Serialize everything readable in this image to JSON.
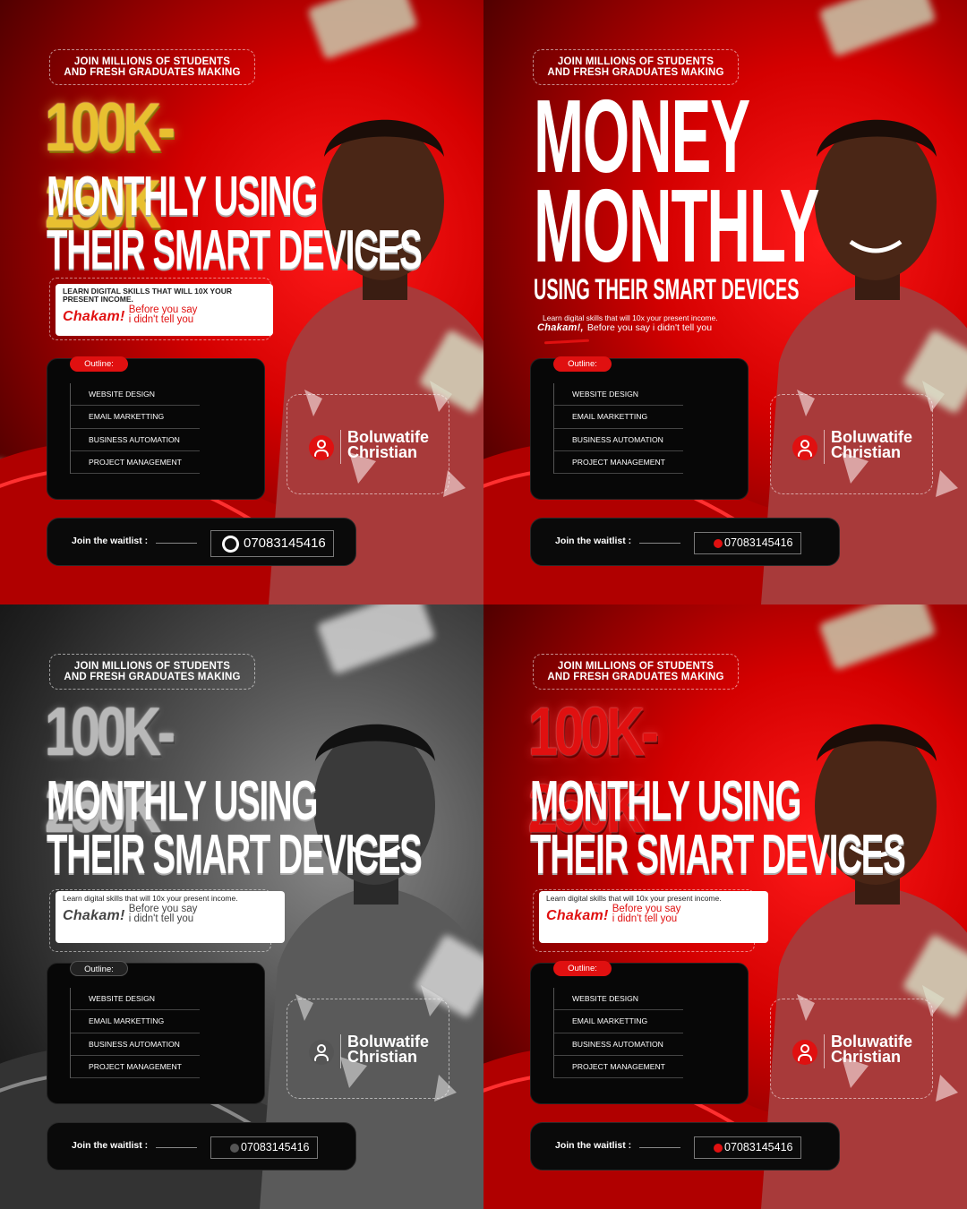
{
  "posters": [
    {
      "variant": "gold",
      "top_line1": "JOIN MILLIONS OF STUDENTS",
      "top_line2": "AND FRESH GRADUATES MAKING",
      "headline_number": "100K-250K",
      "headline_line1": "MONTHLY USING",
      "headline_line2": "THEIR SMART DEVICES",
      "skill_text": "LEARN DIGITAL SKILLS THAT WILL 10X YOUR PRESENT INCOME.",
      "chakam": "Chakam!",
      "before_line1": "Before you say",
      "before_line2": "i didn't tell you",
      "outline_label": "Outline:",
      "outline_items": [
        "WEBSITE DESIGN",
        "EMAIL MARKETTING",
        "BUSINESS AUTOMATION",
        "PROJECT MANAGEMENT"
      ],
      "name_line1": "Boluwatife",
      "name_line2": "Christian",
      "waitlist_label": "Join the waitlist :",
      "phone": "07083145416"
    },
    {
      "variant": "money",
      "top_line1": "JOIN MILLIONS OF STUDENTS",
      "top_line2": "AND FRESH GRADUATES MAKING",
      "headline_line1": "MONEY",
      "headline_line2": "MONTHLY",
      "headline_sub": "USING THEIR SMART DEVICES",
      "skill_text": "Learn  digital skills that will 10x your present income.",
      "chakam": "Chakam!,",
      "before_inline": "Before you say i didn't tell you",
      "outline_label": "Outline:",
      "outline_items": [
        "WEBSITE DESIGN",
        "EMAIL MARKETTING",
        "BUSINESS AUTOMATION",
        "PROJECT MANAGEMENT"
      ],
      "name_line1": "Boluwatife",
      "name_line2": "Christian",
      "waitlist_label": "Join the waitlist :",
      "phone": "07083145416"
    },
    {
      "variant": "silver",
      "top_line1": "JOIN MILLIONS OF STUDENTS",
      "top_line2": "AND FRESH GRADUATES MAKING",
      "headline_number": "100K-250K",
      "headline_line1": "MONTHLY USING",
      "headline_line2": "THEIR SMART DEVICES",
      "skill_text": "Learn  digital skills that will 10x your present income.",
      "chakam": "Chakam!",
      "before_line1": "Before you say",
      "before_line2": "i didn't tell you",
      "outline_label": "Outline:",
      "outline_items": [
        "WEBSITE DESIGN",
        "EMAIL MARKETTING",
        "BUSINESS AUTOMATION",
        "PROJECT MANAGEMENT"
      ],
      "name_line1": "Boluwatife",
      "name_line2": "Christian",
      "waitlist_label": "Join the waitlist :",
      "phone": "07083145416"
    },
    {
      "variant": "red",
      "top_line1": "JOIN MILLIONS OF STUDENTS",
      "top_line2": "AND FRESH GRADUATES MAKING",
      "headline_number": "100K-250K",
      "headline_line1": "MONTHLY USING",
      "headline_line2": "THEIR SMART DEVICES",
      "skill_text": "Learn  digital skills that will 10x your present income.",
      "chakam": "Chakam!",
      "before_line1": "Before you say",
      "before_line2": "i didn't tell you",
      "outline_label": "Outline:",
      "outline_items": [
        "WEBSITE DESIGN",
        "EMAIL MARKETTING",
        "BUSINESS AUTOMATION",
        "PROJECT MANAGEMENT"
      ],
      "name_line1": "Boluwatife",
      "name_line2": "Christian",
      "waitlist_label": "Join the waitlist :",
      "phone": "07083145416"
    }
  ],
  "colors": {
    "accent_red": "#e01010",
    "gold": "#e8c030",
    "dark_card": "#070707"
  }
}
